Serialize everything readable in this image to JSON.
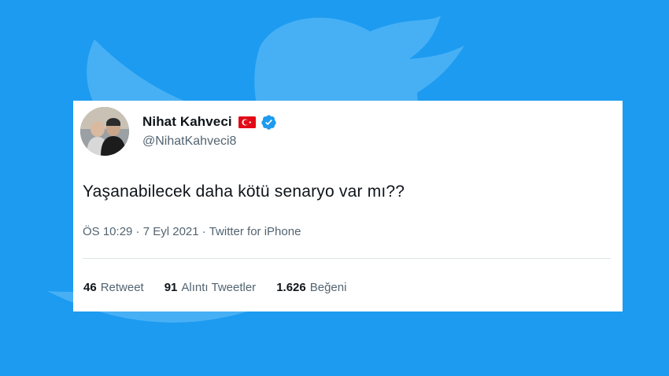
{
  "colors": {
    "background": "#1d9bf0",
    "bird_watermark": "#4cb3f5",
    "verified_badge": "#1d9bf0",
    "flag_red": "#e30a17"
  },
  "icons": [
    "twitter-bird-watermark",
    "turkey-flag-icon",
    "verified-badge-icon"
  ],
  "tweet": {
    "author_name": "Nihat Kahveci",
    "handle": "@NihatKahveci8",
    "text": "Yaşanabilecek daha kötü senaryo var mı??",
    "time": "ÖS 10:29",
    "date": "7 Eyl 2021",
    "source": "Twitter for iPhone",
    "separator": " · "
  },
  "stats": {
    "retweets": {
      "count": "46",
      "label": "Retweet"
    },
    "quotes": {
      "count": "91",
      "label": "Alıntı Tweetler"
    },
    "likes": {
      "count": "1.626",
      "label": "Beğeni"
    }
  }
}
